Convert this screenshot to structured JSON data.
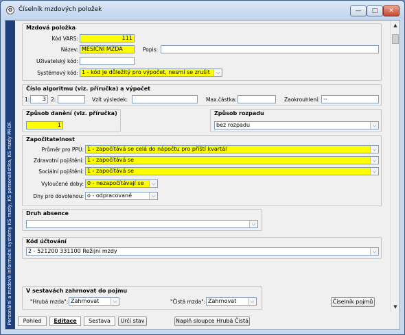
{
  "window": {
    "title": "Číselník mzdových položek",
    "min": "—",
    "max": "□",
    "close": "✕"
  },
  "sidebar": {
    "text": "Personální a mzdové informační systémy KS mzdy, KS personalistika, KS mzdy PROF."
  },
  "mzdova_polozka": {
    "title": "Mzdová položka",
    "kod_vars_label": "Kód VARS:",
    "kod_vars_value": "111",
    "nazev_label": "Název:",
    "nazev_value": "MĚSÍČNÍ  MZDA",
    "popis_label": "Popis:",
    "popis_value": "",
    "uziv_kod_label": "Uživatelský kód:",
    "uziv_kod_value": "",
    "system_kod_label": "Systémový kód:",
    "system_kod_value": "1 - kód je důležitý pro výpočet, nesmí se zrušit"
  },
  "algoritmus": {
    "title": "Číslo algoritmu (viz. příručka) a výpočet",
    "l1": "1:",
    "v1": "3",
    "l2": "2:",
    "v2": "",
    "vysledek_label": "Vzít výsledek:",
    "vysledek_value": "",
    "max_label": "Max.částka:",
    "max_value": "",
    "zaokr_label": "Zaokrouhlení:",
    "zaokr_value": "--"
  },
  "zpusob_daneni": {
    "title": "Způsob danění (viz. příručka)",
    "value": "1"
  },
  "zpusob_rozpadu": {
    "title": "Způsob rozpadu",
    "value": "bez rozpadu"
  },
  "zapocitatelnost": {
    "title": "Započitatelnost",
    "prumer_label": "Průměr pro PPÚ:",
    "prumer_value": "1 - započítává se celá do nápočtu pro příští kvartál",
    "zdrav_label": "Zdravotní pojištění:",
    "zdrav_value": "1 - započítává se",
    "soc_label": "Sociální pojištění:",
    "soc_value": "1 - započítává se",
    "vylouc_label": "Vyloučené doby:",
    "vylouc_value": "0 - nezapočítávají se",
    "dny_label": "Dny pro dovolenou:",
    "dny_value": "o - odpracované"
  },
  "druh_absence": {
    "title": "Druh absence",
    "value": ""
  },
  "kod_uctovani": {
    "title": "Kód účtování",
    "value": "2 - 521200 331100 Režijní mzdy"
  },
  "sestavy": {
    "title": "V sestavách zahrnovat do pojmu",
    "hruba_label": "\"Hrubá mzda\":",
    "hruba_value": "Zahrnovat",
    "cista_label": "\"Čistá mzda\":",
    "cista_value": "Zahrnovat",
    "ciselnik_btn": "Číselník pojmů"
  },
  "bottom": {
    "pohled": "Pohled",
    "editace": "Editace",
    "sestava": "Sestava",
    "urci_stav": "Určí stav",
    "napln": "Naplň sloupce Hrubá Čistá"
  },
  "icons": {
    "dropdown": "⌵",
    "scroll_up": "▲",
    "scroll_down": "▼"
  }
}
